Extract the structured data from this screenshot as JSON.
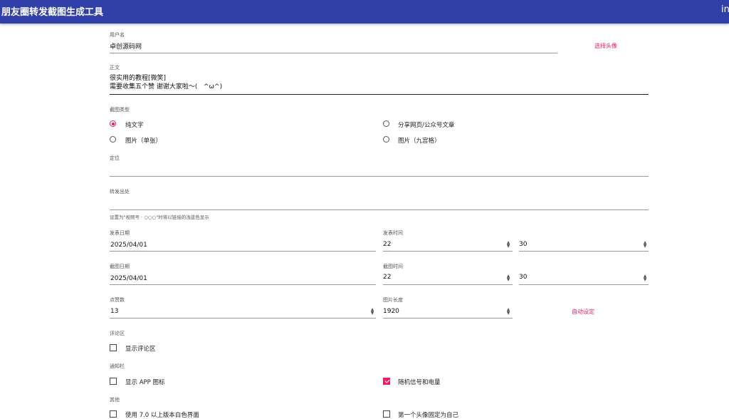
{
  "header": {
    "title": "朋友圈转发截图生成工具",
    "right_text": "in"
  },
  "username": {
    "label": "用户名",
    "value": "卓创源码网",
    "avatar_button": "选择头像"
  },
  "body": {
    "label": "正文",
    "line1": "很实用的教程[微笑]",
    "line2": "需要收集五个赞 谢谢大家啦～(   ^ω^)"
  },
  "screenshot_type": {
    "label": "截图类型",
    "options": [
      "纯文字",
      "分享网页/公众号文章",
      "图片（单张）",
      "图片（九宫格）"
    ],
    "selected": "纯文字"
  },
  "location": {
    "label": "定位",
    "value": ""
  },
  "source": {
    "label": "转发出处",
    "value": "",
    "hint": "设置为\"视频号 · ○○○\"时将以链接的浅蓝色显示"
  },
  "publish": {
    "date_label": "发表日期",
    "date": "2025/04/01",
    "time_label": "发表时间",
    "hour": "22",
    "minute": "30"
  },
  "capture": {
    "date_label": "截图日期",
    "date": "2025/04/01",
    "time_label": "截图时间",
    "hour": "22",
    "minute": "30"
  },
  "likes": {
    "label": "点赞数",
    "value": "13"
  },
  "image_length": {
    "label": "图片长度",
    "value": "1920",
    "auto_button": "自动设定"
  },
  "comments": {
    "section": "评论区",
    "show_label": "显示评论区",
    "checked": false
  },
  "notification": {
    "section": "通知栏",
    "show_app_icon": "显示 APP 图标",
    "random_signal": "随机信号和电量"
  },
  "other": {
    "section": "其他",
    "white_ui": "使用 7.0 以上版本白色界面",
    "first_avatar_self": "第一个头像固定为自己"
  },
  "icons": {
    "spinner": "spinner-arrows-icon"
  }
}
